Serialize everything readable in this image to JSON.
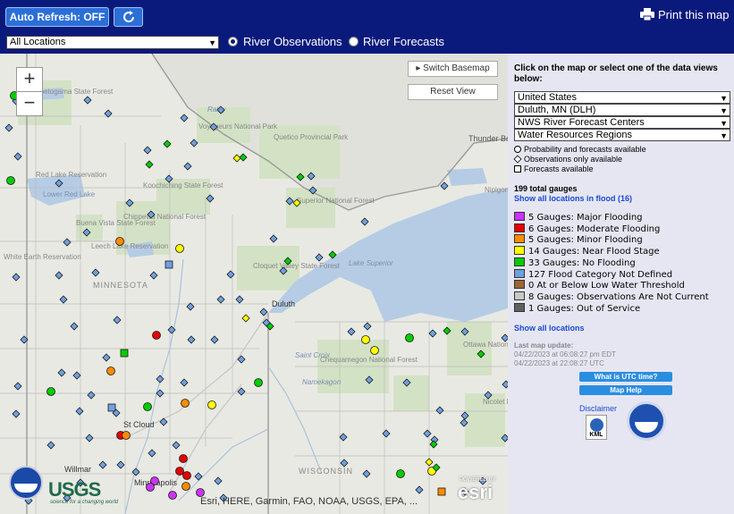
{
  "toolbar": {
    "auto_refresh_label": "Auto Refresh: OFF",
    "refresh_icon": "refresh-icon",
    "print_label": "Print this map",
    "print_icon": "printer-icon",
    "location_select": "All Locations",
    "radio_observations": "River Observations",
    "radio_forecasts": "River Forecasts",
    "selected_radio": "River Observations"
  },
  "map": {
    "zoom_in": "+",
    "zoom_out": "−",
    "switch_basemap": "Switch Basemap",
    "switch_basemap_icon": "caret-right-icon",
    "reset_view": "Reset View",
    "attribution": "Esri, HERE, Garmin, FAO, NOAA, USGS, EPA, ...",
    "usgs_logo": "USGS",
    "usgs_tagline": "science for a changing world",
    "esri_powered": "POWERED BY",
    "esri_logo": "esri",
    "labels": [
      {
        "text": "Rainy",
        "color": "#7a8fb0"
      },
      {
        "text": "Kabetogama State Forest"
      },
      {
        "text": "Voyageurs National Park"
      },
      {
        "text": "Quetico Provincial Park"
      },
      {
        "text": "Thunder Bay"
      },
      {
        "text": "Red Lake Reservation"
      },
      {
        "text": "Lower Red Lake"
      },
      {
        "text": "Koochiching State Forest"
      },
      {
        "text": "Chippewa National Forest"
      },
      {
        "text": "Superior National Forest"
      },
      {
        "text": "Leech Lake Reservation"
      },
      {
        "text": "Buena Vista State Forest"
      },
      {
        "text": "White Earth Reservation"
      },
      {
        "text": "MINNESOTA"
      },
      {
        "text": "Cloquet Valley State Forest"
      },
      {
        "text": "Lake Superior"
      },
      {
        "text": "Duluth"
      },
      {
        "text": "Saint Croix"
      },
      {
        "text": "Chequamegon National Forest"
      },
      {
        "text": "Ottawa National Forest"
      },
      {
        "text": "Nicolet National Forest"
      },
      {
        "text": "St Cloud"
      },
      {
        "text": "Willmar"
      },
      {
        "text": "Minneapolis"
      },
      {
        "text": "WISCONSIN"
      },
      {
        "text": "Namekagon"
      },
      {
        "text": "Nipigon"
      }
    ],
    "gauge_colors": {
      "major": "#cc33ff",
      "moderate": "#e60000",
      "minor": "#ff8c00",
      "near": "#ffff00",
      "none": "#00cc00",
      "undefined": "#6fa0e0",
      "low": "#996633",
      "not_current": "#c8c8c8",
      "out": "#606060"
    }
  },
  "panel": {
    "instructions": "Click on the map or select one of the data views below:",
    "selects": [
      "United States",
      "Duluth, MN (DLH)",
      "NWS River Forecast Centers",
      "Water Resources Regions"
    ],
    "symbol_legend": [
      {
        "shape": "circle",
        "label": "Probability and forecasts available"
      },
      {
        "shape": "diamond",
        "label": "Observations only available"
      },
      {
        "shape": "square",
        "label": "Forecasts available"
      }
    ],
    "total_gauges": "199 total gauges",
    "flood_link": "Show all locations in flood (16)",
    "categories": [
      {
        "label": "5 Gauges: Major Flooding",
        "color": "#cc33ff"
      },
      {
        "label": "6 Gauges: Moderate Flooding",
        "color": "#e60000"
      },
      {
        "label": "5 Gauges: Minor Flooding",
        "color": "#ff8c00"
      },
      {
        "label": "14 Gauges: Near Flood Stage",
        "color": "#ffff00"
      },
      {
        "label": "33 Gauges: No Flooding",
        "color": "#00cc00"
      },
      {
        "label": "127 Flood Category Not Defined",
        "color": "#6fa0e0"
      },
      {
        "label": "0 At or Below Low Water Threshold",
        "color": "#996633"
      },
      {
        "label": "8 Gauges: Observations Are Not Current",
        "color": "#c8c8c8"
      },
      {
        "label": "1 Gauges: Out of Service",
        "color": "#606060"
      }
    ],
    "show_all": "Show all locations",
    "last_update_label": "Last map update:",
    "update_edt": "04/22/2023 at 06:08:27 pm EDT",
    "update_utc": "04/22/2023 at 22:08:27 UTC",
    "utc_button": "What is UTC time?",
    "help_button": "Map Help",
    "disclaimer": "Disclaimer",
    "kml_label": "KML"
  }
}
